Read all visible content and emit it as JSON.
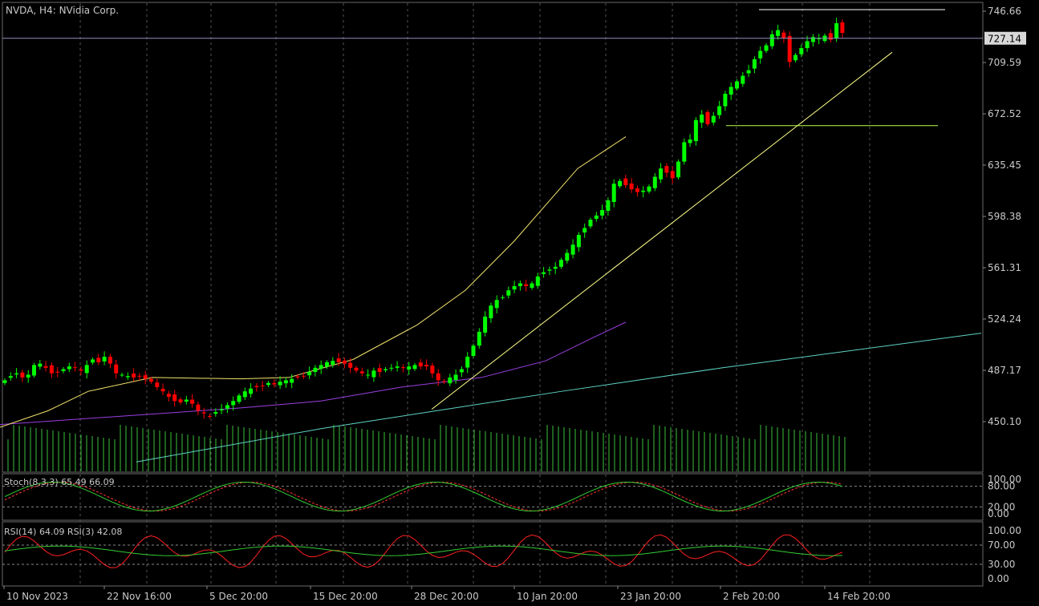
{
  "header": {
    "title": "NVDA, H4:  NVidia Corp."
  },
  "colors": {
    "background": "#000000",
    "grid": "#555555",
    "axis_text": "#c8c8c8",
    "bull_candle": "#00ff00",
    "bear_candle": "#ff0000",
    "ma_yellow": "#f3e36b",
    "ma_purple": "#9b3fe0",
    "ma_teal": "#5fd3c4",
    "trendline": "#ffff88",
    "hline_support": "#b7ff4a",
    "volume": "#3cbf3c",
    "stoch_main": "#33cc33",
    "stoch_signal": "#ff3333",
    "rsi_14": "#33cc33",
    "rsi_3": "#ff2020",
    "price_line": "#9090c0"
  },
  "chart_data": [
    {
      "type": "candlestick",
      "title": "NVDA, H4:  NVidia Corp.",
      "ylim": [
        441.0,
        752.0
      ],
      "y_ticks": [
        "746.66",
        "709.59",
        "672.52",
        "635.45",
        "598.38",
        "561.31",
        "524.24",
        "487.17",
        "450.10"
      ],
      "current_price": "727.14",
      "x_labels": [
        "10 Nov 2023",
        "22 Nov 16:00",
        "5 Dec 20:00",
        "15 Dec 20:00",
        "28 Dec 20:00",
        "10 Jan 20:00",
        "23 Jan 20:00",
        "2 Feb 20:00",
        "14 Feb 20:00"
      ],
      "closes": [
        480,
        483,
        485,
        482,
        484,
        491,
        492,
        489,
        485,
        486,
        488,
        490,
        489,
        487,
        491,
        495,
        493,
        497,
        492,
        485,
        484,
        483,
        482,
        483,
        481,
        479,
        475,
        472,
        468,
        465,
        464,
        466,
        463,
        458,
        456,
        454,
        457,
        459,
        462,
        465,
        469,
        472,
        474,
        475,
        476,
        478,
        477,
        479,
        480,
        481,
        482,
        483,
        486,
        489,
        491,
        493,
        494,
        493,
        492,
        489,
        487,
        485,
        484,
        487,
        486,
        488,
        489,
        490,
        489,
        490,
        491,
        490,
        490,
        485,
        480,
        479,
        482,
        484,
        488,
        497,
        505,
        515,
        526,
        534,
        538,
        540,
        545,
        548,
        550,
        548,
        550,
        555,
        558,
        560,
        562,
        567,
        572,
        578,
        585,
        590,
        596,
        599,
        603,
        610,
        622,
        624,
        621,
        618,
        616,
        617,
        620,
        627,
        633,
        630,
        626,
        638,
        652,
        654,
        668,
        672,
        665,
        671,
        678,
        687,
        692,
        696,
        700,
        704,
        712,
        718,
        722,
        730,
        733,
        727,
        710,
        715,
        720,
        725,
        728,
        727,
        729,
        726,
        738,
        731
      ],
      "volume_bars": 150,
      "indicators": {
        "ma_yellow": [
          [
            0,
            446
          ],
          [
            60,
            458
          ],
          [
            110,
            472
          ],
          [
            190,
            482
          ],
          [
            300,
            481
          ],
          [
            360,
            482
          ],
          [
            440,
            495
          ],
          [
            520,
            520
          ],
          [
            580,
            545
          ],
          [
            640,
            580
          ],
          [
            720,
            633
          ],
          [
            780,
            656
          ]
        ],
        "ma_purple": [
          [
            0,
            448
          ],
          [
            200,
            456
          ],
          [
            300,
            460
          ],
          [
            400,
            465
          ],
          [
            500,
            475
          ],
          [
            600,
            482
          ],
          [
            680,
            494
          ],
          [
            740,
            511
          ],
          [
            780,
            522
          ]
        ],
        "ma_teal": [
          [
            170,
            421
          ],
          [
            400,
            445
          ],
          [
            700,
            472
          ],
          [
            900,
            489
          ],
          [
            1223,
            514
          ]
        ],
        "trendline_from": [
          538,
          459
        ],
        "trendline_to": [
          1112,
          717
        ],
        "resistance_y": 747.8,
        "support_y": 664.0
      }
    },
    {
      "type": "line",
      "title": "Stoch(8,3,3) 65.49 66.09",
      "y_ticks": [
        "100.00",
        "80.00",
        "20.00",
        "0.00"
      ],
      "levels": [
        80,
        20
      ]
    },
    {
      "type": "line",
      "title": "RSI(14) 64.09 RSI(3) 42.08",
      "y_ticks": [
        "100.00",
        "70.00",
        "30.00",
        "0.00"
      ],
      "levels": [
        70,
        30
      ]
    }
  ]
}
